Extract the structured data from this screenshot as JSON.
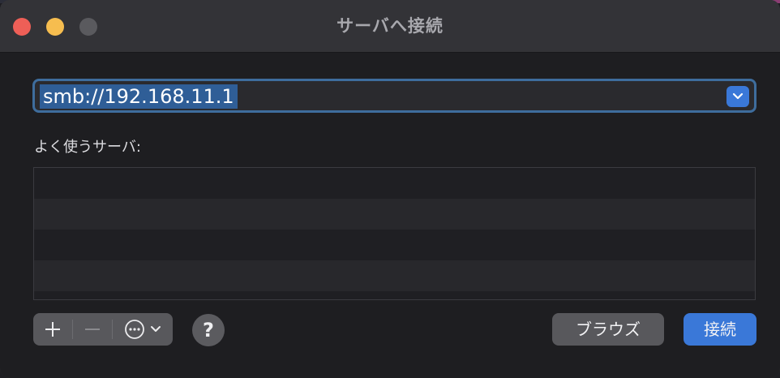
{
  "window": {
    "title": "サーバへ接続"
  },
  "address": {
    "value": "smb://192.168.11.1",
    "dropdown_icon": "chevron-down-icon"
  },
  "favorites": {
    "label": "よく使うサーバ:",
    "rows": [
      "",
      "",
      "",
      ""
    ]
  },
  "toolbar": {
    "add_icon": "plus-icon",
    "remove_icon": "minus-icon",
    "more_icon": "ellipsis-circle-icon",
    "help_label": "?",
    "browse_label": "ブラウズ",
    "connect_label": "接続"
  },
  "colors": {
    "accent": "#3a78d8",
    "selection": "#2f5e97"
  }
}
